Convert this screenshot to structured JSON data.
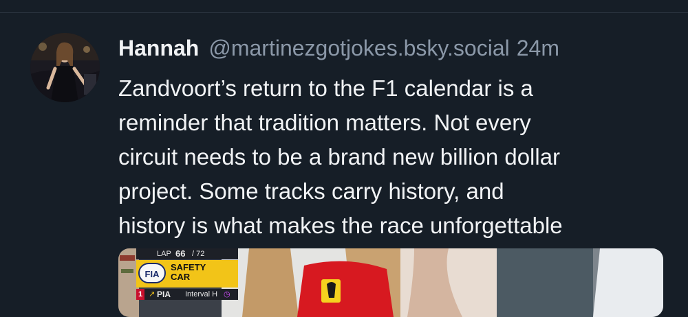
{
  "post": {
    "author_name": "Hannah",
    "handle": "@martinezgotjokes.bsky.social",
    "timestamp": "24m",
    "text_lines": [
      "Zandvoort’s return to the F1 calendar is a",
      "reminder that tradition matters. Not every",
      "circuit needs to be a brand new billion dollar",
      "project. Some tracks carry history, and",
      "history is what makes the race unforgettable"
    ]
  },
  "media": {
    "lap_label": "LAP",
    "lap_current": "66",
    "lap_total": "/ 72",
    "fia_label": "FIA",
    "safety_car_line1": "SAFETY",
    "safety_car_line2": "CAR",
    "position": "1",
    "driver_code": "PIA",
    "interval_label": "Interval H"
  },
  "icons": {
    "avatar": "profile-photo",
    "position_arrow": "up-arrow-icon",
    "timer": "timer-icon"
  },
  "colors": {
    "background": "#161e27",
    "text_primary": "#f1f3f5",
    "text_secondary": "#8b98a8",
    "safety_car_yellow": "#f2c418",
    "ferrari_red": "#d71920"
  }
}
